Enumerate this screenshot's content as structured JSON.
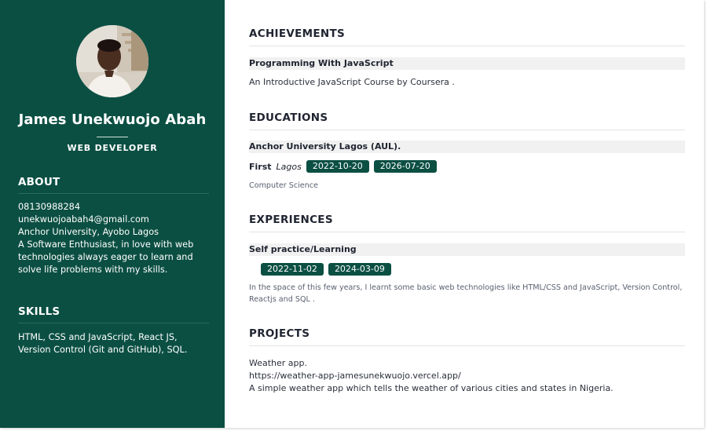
{
  "profile": {
    "name": "James Unekwuojo Abah",
    "role": "WEB DEVELOPER"
  },
  "about": {
    "heading": "ABOUT",
    "phone": "08130988284",
    "email": "unekwuojoabah4@gmail.com",
    "location": "Anchor University, Ayobo Lagos",
    "bio": "A Software Enthusiast, in love with web technologies always eager to learn and solve life problems with my skills."
  },
  "skills": {
    "heading": "SKILLS",
    "text": "HTML, CSS and JavaScript, React JS, Version Control (Git and GitHub), SQL."
  },
  "achievements": {
    "heading": "ACHIEVEMENTS",
    "title": "Programming With JavaScript",
    "description": "An Introductive JavaScript Course by Coursera ."
  },
  "educations": {
    "heading": "EDUCATIONS",
    "school": "Anchor University Lagos (AUL).",
    "grade": "First",
    "location": "Lagos",
    "start": "2022-10-20",
    "end": "2026-07-20",
    "course": "Computer Science"
  },
  "experiences": {
    "heading": "EXPERIENCES",
    "title": "Self practice/Learning",
    "start": "2022-11-02",
    "end": "2024-03-09",
    "description": "In the space of this few years, I learnt some basic web technologies like HTML/CSS and JavaScript, Version Control, Reactjs and SQL ."
  },
  "projects": {
    "heading": "PROJECTS",
    "name": "Weather app.",
    "url": "https://weather-app-jamesunekwuojo.vercel.app/",
    "description": "A simple weather app which tells the weather of various cities and states in Nigeria."
  },
  "colors": {
    "sidebar": "#0b4f43",
    "badge": "#0b4f43",
    "heading": "#1f2430"
  }
}
